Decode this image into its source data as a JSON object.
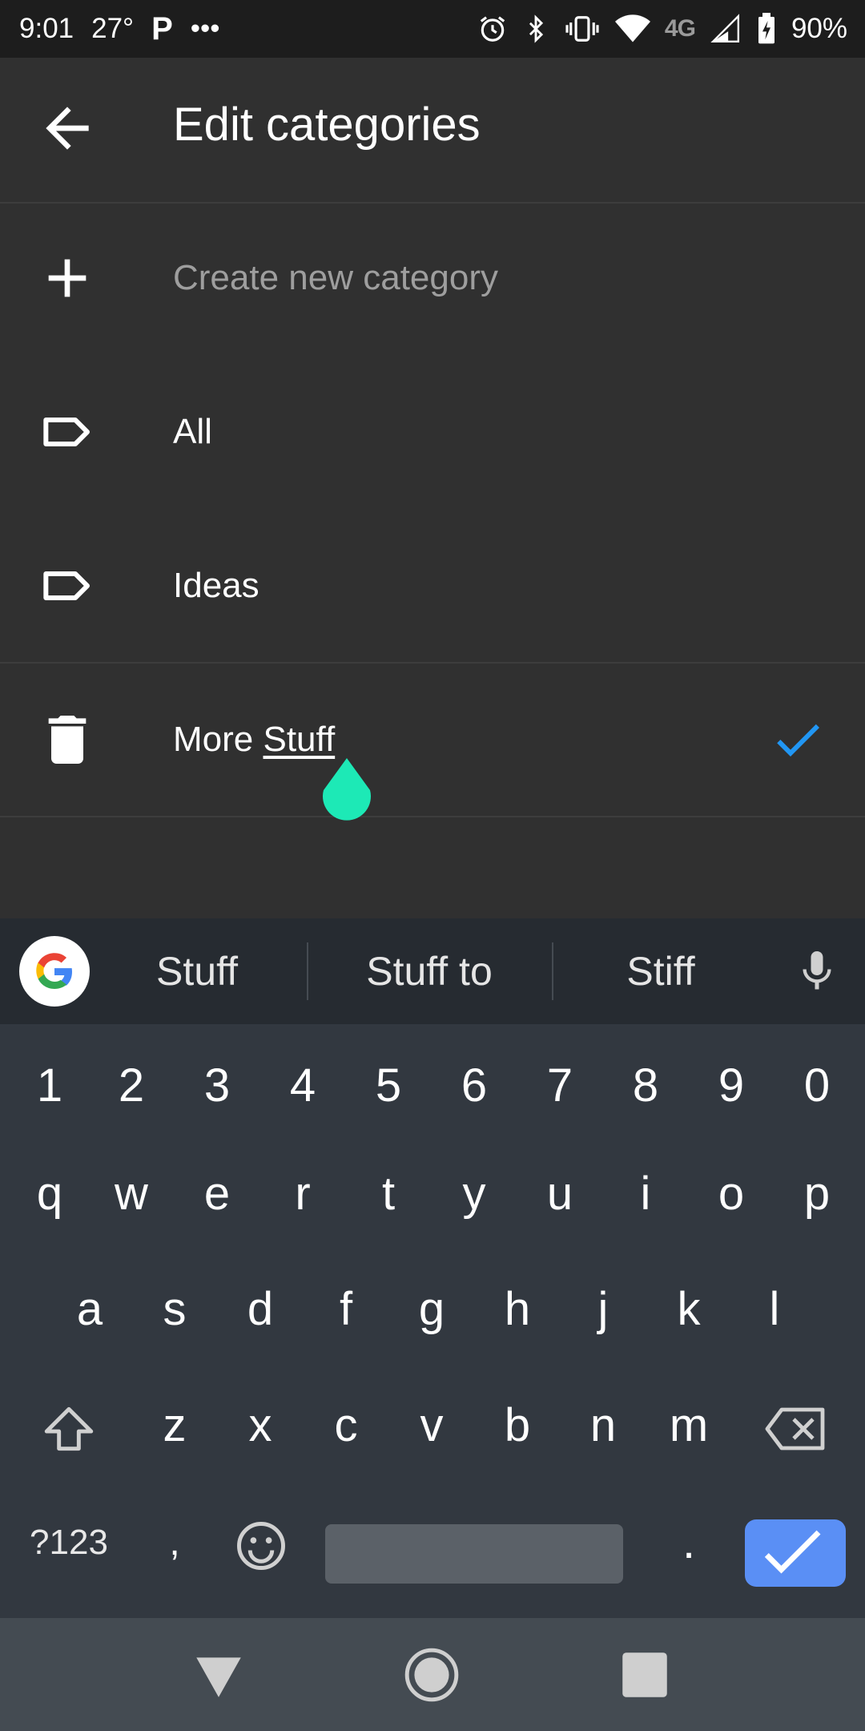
{
  "status_bar": {
    "time": "9:01",
    "temperature": "27°",
    "p_badge": "P",
    "dots": "•••",
    "network": "4G",
    "battery": "90%"
  },
  "app_bar": {
    "back_icon": "arrow-back-icon",
    "title": "Edit categories"
  },
  "list": {
    "create": {
      "icon": "plus-icon",
      "label": "Create new category"
    },
    "items": [
      {
        "icon": "label-icon",
        "label": "All"
      },
      {
        "icon": "label-icon",
        "label": "Ideas"
      }
    ],
    "editing": {
      "icon": "trash-icon",
      "text_prefix": "More ",
      "text_underlined": "Stuff",
      "confirm_icon": "checkmark-icon"
    }
  },
  "keyboard": {
    "suggestions": [
      "Stuff",
      "Stuff to",
      "Stiff"
    ],
    "number_row": [
      "1",
      "2",
      "3",
      "4",
      "5",
      "6",
      "7",
      "8",
      "9",
      "0"
    ],
    "row1": [
      "q",
      "w",
      "e",
      "r",
      "t",
      "y",
      "u",
      "i",
      "o",
      "p"
    ],
    "row2": [
      "a",
      "s",
      "d",
      "f",
      "g",
      "h",
      "j",
      "k",
      "l"
    ],
    "row3": [
      "z",
      "x",
      "c",
      "v",
      "b",
      "n",
      "m"
    ],
    "symbols_key": "?123",
    "comma_key": ",",
    "period_key": ".",
    "colors": {
      "accent": "#5a8ff5",
      "background": "#323840",
      "suggestion_bar": "#262b31"
    }
  },
  "colors": {
    "background": "#303030",
    "status_bar": "#1d1d1d",
    "check_blue": "#2196f3",
    "cursor_handle": "#1de9b6",
    "nav_bar": "#444b52"
  }
}
